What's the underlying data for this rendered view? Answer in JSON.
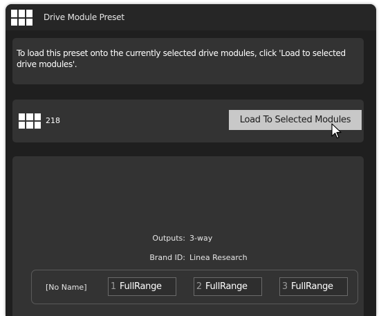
{
  "window": {
    "title": "Drive Module Preset",
    "icon": "grid-icon"
  },
  "info": {
    "text": "To load this preset onto the currently selected drive modules, click 'Load to selected drive modules'."
  },
  "preset": {
    "number": "218",
    "icon": "grid-icon",
    "load_button_label": "Load To Selected Modules"
  },
  "details": {
    "outputs_label": "Outputs:",
    "outputs_value": "3-way",
    "brand_label": "Brand ID:",
    "brand_value": "Linea Research",
    "module_name": "[No Name]",
    "outputs": [
      {
        "index": "1",
        "name": "FullRange"
      },
      {
        "index": "2",
        "name": "FullRange"
      },
      {
        "index": "3",
        "name": "FullRange"
      }
    ]
  },
  "colors": {
    "background": "#1f1f1f",
    "panel": "#333333",
    "button": "#c8c8c8",
    "text": "#ffffff"
  }
}
